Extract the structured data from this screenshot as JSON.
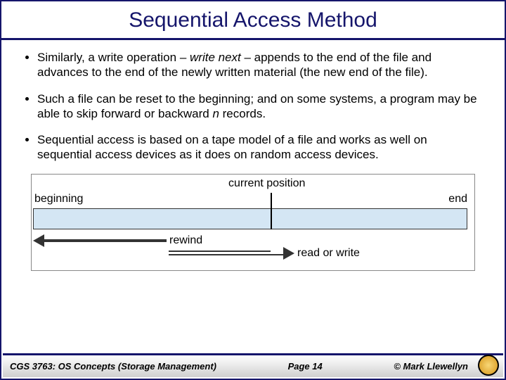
{
  "title": "Sequential Access Method",
  "bullets": [
    {
      "pre": "Similarly, a write operation – ",
      "em": "write next",
      "post": " – appends to the end of the file and advances to the end of the newly written material (the new end of the file)."
    },
    {
      "pre": "Such a file can be reset to the beginning; and on some systems, a program may be able to skip forward or backward ",
      "em": "n",
      "post": " records."
    },
    {
      "pre": "Sequential access is based on a tape model of a file and works as well on sequential access devices as it does on random access devices.",
      "em": "",
      "post": ""
    }
  ],
  "diagram": {
    "current_position": "current position",
    "beginning": "beginning",
    "end": "end",
    "rewind": "rewind",
    "read_or_write": "read or write"
  },
  "footer": {
    "course": "CGS 3763: OS Concepts  (Storage Management)",
    "page": "Page 14",
    "copyright": "© Mark Llewellyn"
  }
}
